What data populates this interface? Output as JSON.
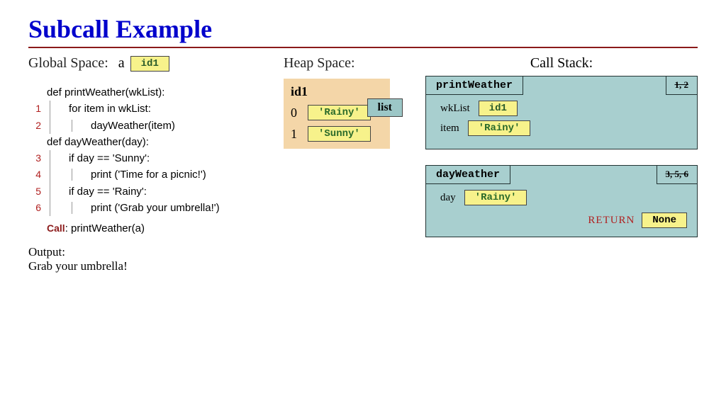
{
  "title": "Subcall Example",
  "global": {
    "label": "Global Space:",
    "var": "a",
    "val": "id1"
  },
  "code": {
    "def1": "def printWeather(wkList):",
    "l1": "for item in wkList:",
    "l2": "dayWeather(item)",
    "def2": "def dayWeather(day):",
    "l3": "if day == 'Sunny':",
    "l4": "print ('Time for a picnic!')",
    "l5": "if day == 'Rainy':",
    "l6": "print ('Grab your umbrella!')",
    "call_label": "Call",
    "call": "printWeather(a)",
    "ln1": "1",
    "ln2": "2",
    "ln3": "3",
    "ln4": "4",
    "ln5": "5",
    "ln6": "6"
  },
  "output": {
    "label": "Output:",
    "text": "Grab your umbrella!"
  },
  "heap": {
    "label": "Heap Space:",
    "id": "id1",
    "type": "list",
    "items": {
      "i0": "0",
      "v0": "'Rainy'",
      "i1": "1",
      "v1": "'Sunny'"
    }
  },
  "stack": {
    "label": "Call Stack:",
    "f1": {
      "name": "printWeather",
      "lines": "1, 2",
      "var1": "wkList",
      "val1": "id1",
      "var2": "item",
      "val2": "'Rainy'"
    },
    "f2": {
      "name": "dayWeather",
      "lines": "3, 5, 6",
      "var1": "day",
      "val1": "'Rainy'",
      "return_label": "RETURN",
      "return_val": "None"
    }
  }
}
